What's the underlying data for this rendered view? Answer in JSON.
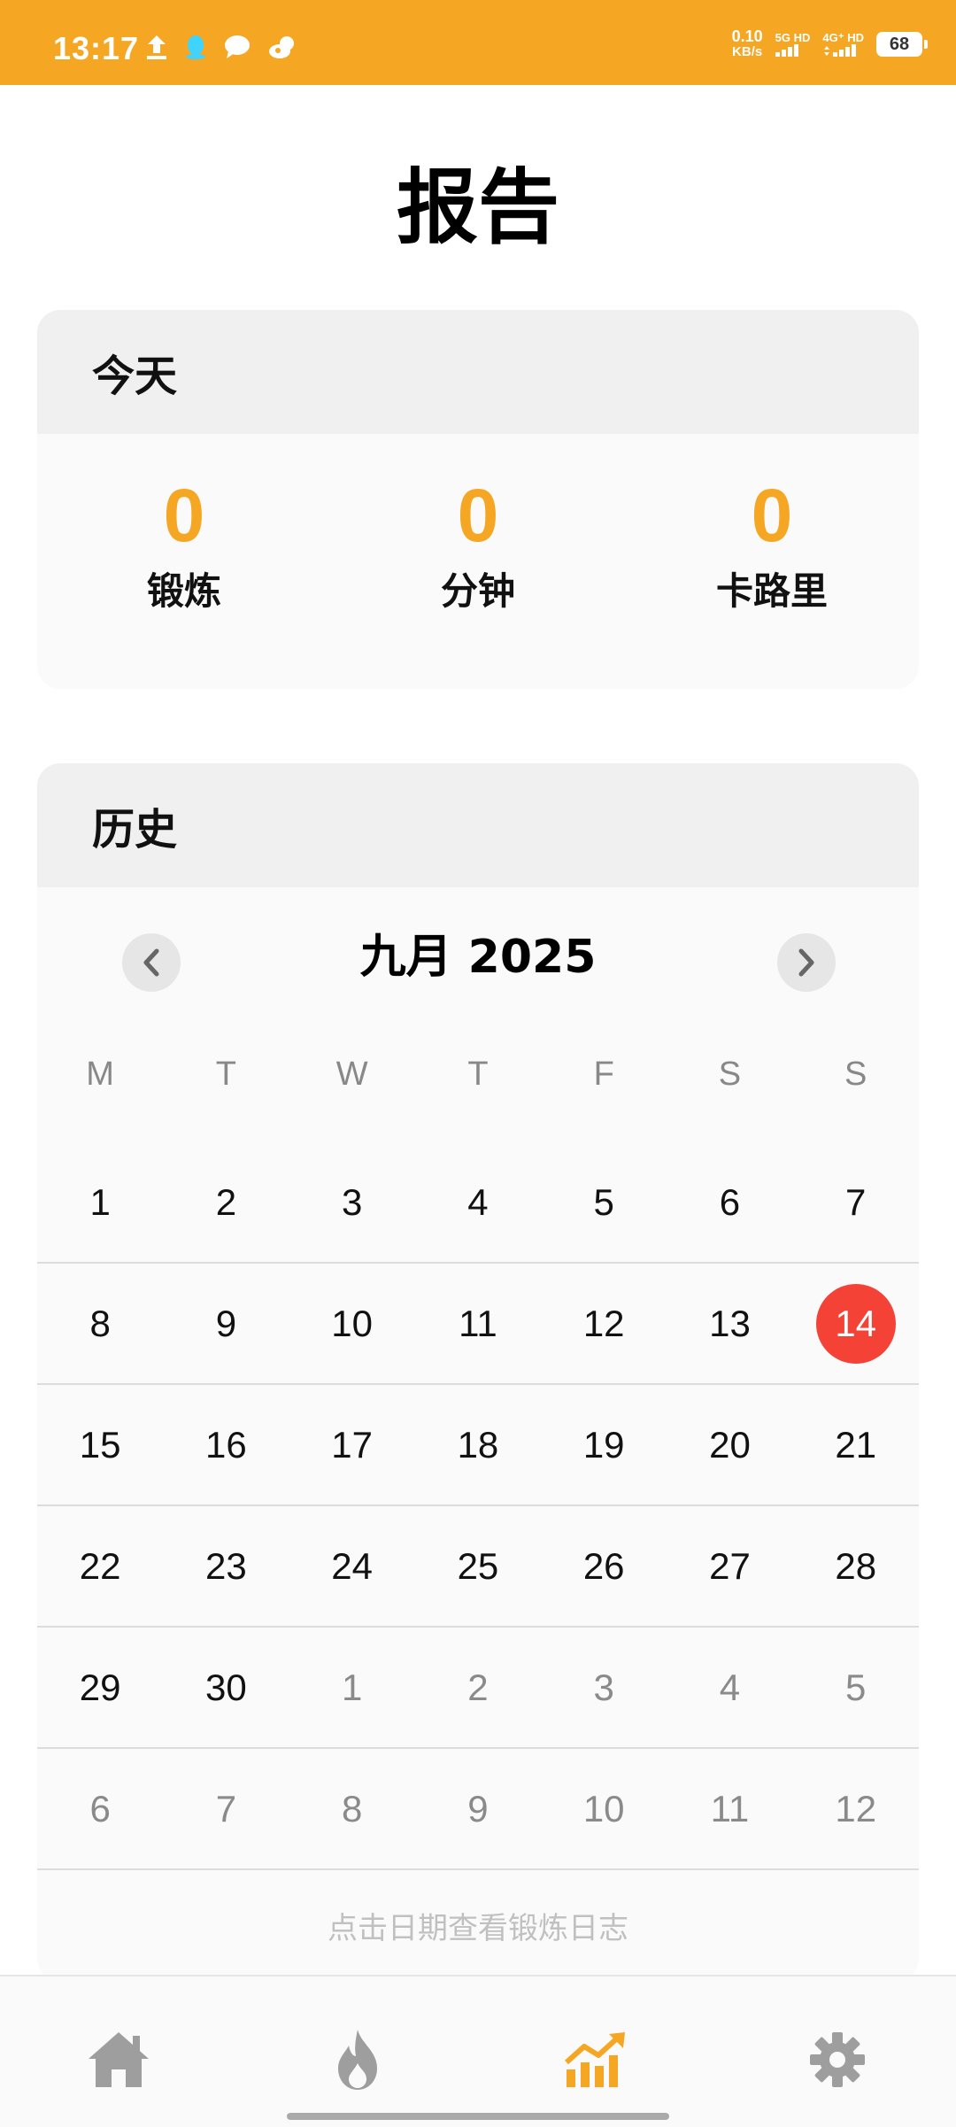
{
  "status_bar": {
    "time": "13:17",
    "net_speed_value": "0.10",
    "net_speed_unit": "KB/s",
    "sim1_label": "5G HD",
    "sim2_label": "4G⁺ HD",
    "battery": "68",
    "colors": {
      "background": "#f5a623"
    }
  },
  "page": {
    "title": "报告"
  },
  "today": {
    "header": "今天",
    "stats": [
      {
        "value": "0",
        "label": "锻炼"
      },
      {
        "value": "0",
        "label": "分钟"
      },
      {
        "value": "0",
        "label": "卡路里"
      }
    ]
  },
  "history": {
    "header": "历史",
    "month_title": "九月 2025",
    "weekdays": [
      "M",
      "T",
      "W",
      "T",
      "F",
      "S",
      "S"
    ],
    "weeks": [
      [
        {
          "d": "1",
          "cur": true
        },
        {
          "d": "2",
          "cur": true
        },
        {
          "d": "3",
          "cur": true
        },
        {
          "d": "4",
          "cur": true
        },
        {
          "d": "5",
          "cur": true
        },
        {
          "d": "6",
          "cur": true
        },
        {
          "d": "7",
          "cur": true
        }
      ],
      [
        {
          "d": "8",
          "cur": true
        },
        {
          "d": "9",
          "cur": true
        },
        {
          "d": "10",
          "cur": true
        },
        {
          "d": "11",
          "cur": true
        },
        {
          "d": "12",
          "cur": true
        },
        {
          "d": "13",
          "cur": true
        },
        {
          "d": "14",
          "cur": true,
          "today": true
        }
      ],
      [
        {
          "d": "15",
          "cur": true
        },
        {
          "d": "16",
          "cur": true
        },
        {
          "d": "17",
          "cur": true
        },
        {
          "d": "18",
          "cur": true
        },
        {
          "d": "19",
          "cur": true
        },
        {
          "d": "20",
          "cur": true
        },
        {
          "d": "21",
          "cur": true
        }
      ],
      [
        {
          "d": "22",
          "cur": true
        },
        {
          "d": "23",
          "cur": true
        },
        {
          "d": "24",
          "cur": true
        },
        {
          "d": "25",
          "cur": true
        },
        {
          "d": "26",
          "cur": true
        },
        {
          "d": "27",
          "cur": true
        },
        {
          "d": "28",
          "cur": true
        }
      ],
      [
        {
          "d": "29",
          "cur": true
        },
        {
          "d": "30",
          "cur": true
        },
        {
          "d": "1",
          "cur": false
        },
        {
          "d": "2",
          "cur": false
        },
        {
          "d": "3",
          "cur": false
        },
        {
          "d": "4",
          "cur": false
        },
        {
          "d": "5",
          "cur": false
        }
      ],
      [
        {
          "d": "6",
          "cur": false
        },
        {
          "d": "7",
          "cur": false
        },
        {
          "d": "8",
          "cur": false
        },
        {
          "d": "9",
          "cur": false
        },
        {
          "d": "10",
          "cur": false
        },
        {
          "d": "11",
          "cur": false
        },
        {
          "d": "12",
          "cur": false
        }
      ]
    ],
    "hint": "点击日期查看锻炼日志",
    "prev_icon": "chevron-left-icon",
    "next_icon": "chevron-right-icon"
  },
  "bottom_nav": {
    "items": [
      {
        "icon": "home-icon",
        "active": false
      },
      {
        "icon": "fire-icon",
        "active": false
      },
      {
        "icon": "chart-icon",
        "active": true
      },
      {
        "icon": "gear-icon",
        "active": false
      }
    ],
    "colors": {
      "active": "#f5a623",
      "inactive": "#9e9e9e"
    }
  }
}
